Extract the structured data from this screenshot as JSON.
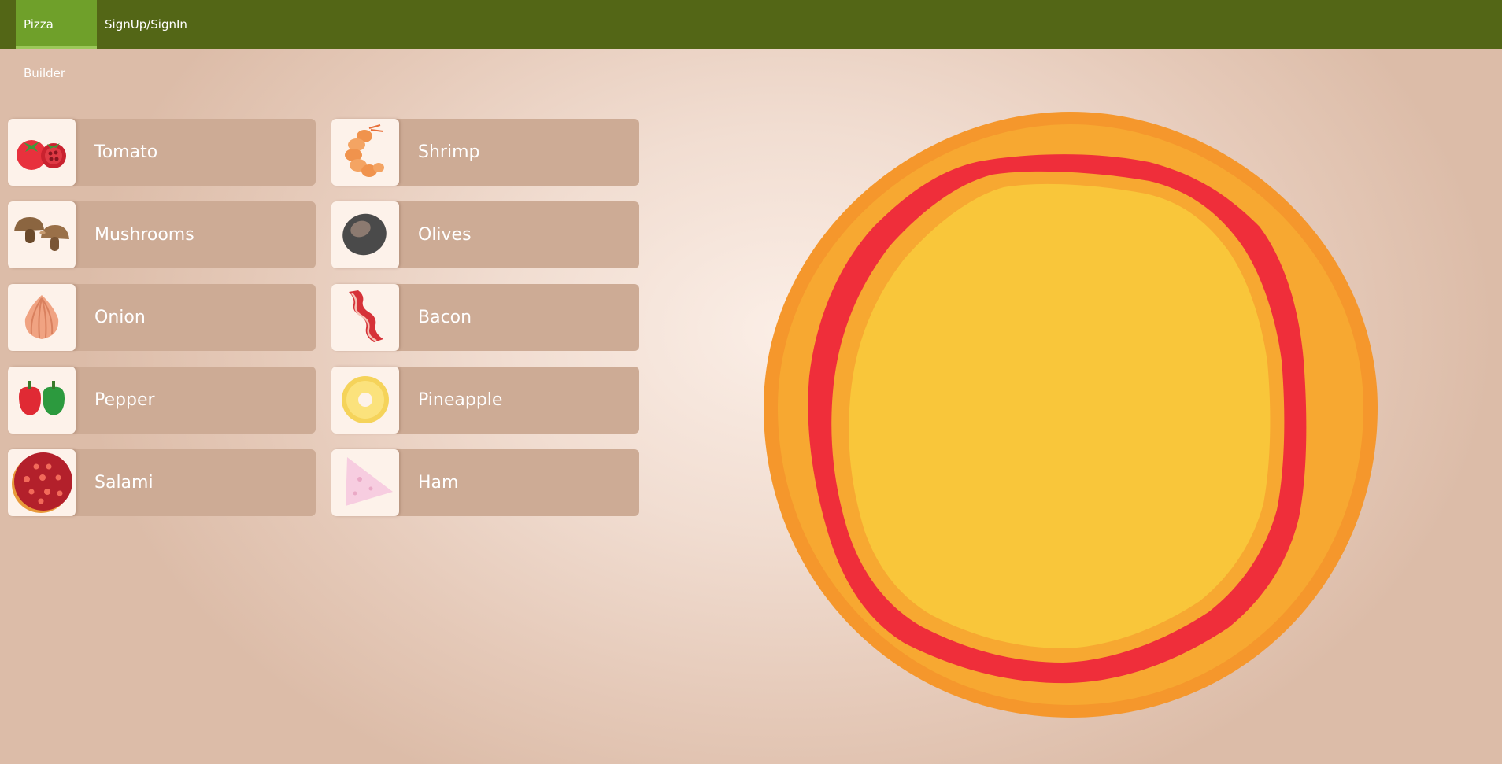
{
  "nav": {
    "items": [
      {
        "label": "Pizza Builder",
        "active": true
      },
      {
        "label": "SignUp/SignIn",
        "active": false
      }
    ]
  },
  "toppings": [
    {
      "label": "Tomato",
      "icon": "tomato-icon"
    },
    {
      "label": "Shrimp",
      "icon": "shrimp-icon"
    },
    {
      "label": "Mushrooms",
      "icon": "mushroom-icon"
    },
    {
      "label": "Olives",
      "icon": "olive-icon"
    },
    {
      "label": "Onion",
      "icon": "onion-icon"
    },
    {
      "label": "Bacon",
      "icon": "bacon-icon"
    },
    {
      "label": "Pepper",
      "icon": "pepper-icon"
    },
    {
      "label": "Pineapple",
      "icon": "pineapple-icon"
    },
    {
      "label": "Salami",
      "icon": "salami-icon"
    },
    {
      "label": "Ham",
      "icon": "ham-icon"
    }
  ],
  "colors": {
    "nav": "#536616",
    "nav_active": "#6fa02a",
    "topping_bg": "#cdab95",
    "crust_outer": "#f5972c",
    "crust_inner": "#f7a831",
    "sauce": "#ef2e3a",
    "cheese": "#f9c63a"
  }
}
